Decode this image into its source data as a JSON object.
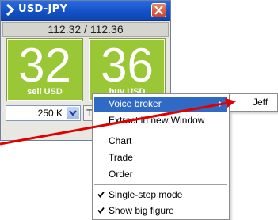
{
  "widget": {
    "title": "USD-JPY",
    "rates": "112.32 / 112.36",
    "sell": {
      "digits": "32",
      "label": "sell USD"
    },
    "buy": {
      "digits": "36",
      "label": "buy USD"
    },
    "amount": "250 K",
    "trade_button": "Trade"
  },
  "context_menu": {
    "items": [
      {
        "label": "Voice broker"
      },
      {
        "label": "Extract in new Window"
      },
      {
        "label": "Chart"
      },
      {
        "label": "Trade"
      },
      {
        "label": "Order"
      },
      {
        "label": "Single-step mode"
      },
      {
        "label": "Show big figure"
      }
    ]
  },
  "submenu": {
    "label": "Jeff"
  },
  "colors": {
    "title_bar": "#1552c8",
    "price_box": "#9ac735",
    "highlight": "#316ac5",
    "annotation_arrow": "#e00000"
  }
}
